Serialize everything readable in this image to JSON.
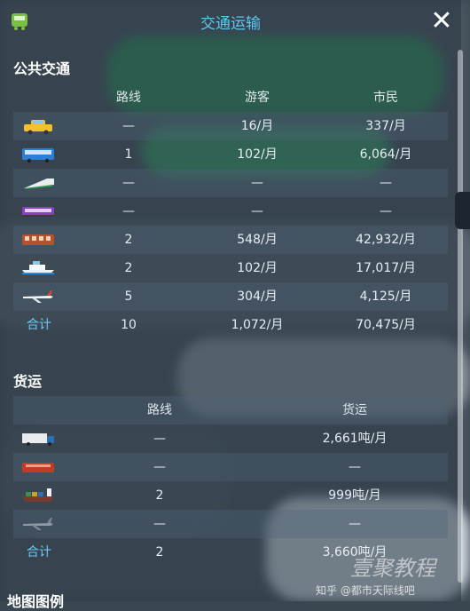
{
  "window": {
    "title": "交通运输"
  },
  "public_transport": {
    "heading": "公共交通",
    "columns": [
      "路线",
      "游客",
      "市民"
    ],
    "rows": [
      {
        "icon": "taxi-icon",
        "routes": "—",
        "tourists": "16/月",
        "citizens": "337/月"
      },
      {
        "icon": "bus-icon",
        "routes": "1",
        "tourists": "102/月",
        "citizens": "6,064/月"
      },
      {
        "icon": "metro-icon",
        "routes": "—",
        "tourists": "—",
        "citizens": "—"
      },
      {
        "icon": "tram-icon",
        "routes": "—",
        "tourists": "—",
        "citizens": "—"
      },
      {
        "icon": "train-icon",
        "routes": "2",
        "tourists": "548/月",
        "citizens": "42,932/月"
      },
      {
        "icon": "ship-icon",
        "routes": "2",
        "tourists": "102/月",
        "citizens": "17,017/月"
      },
      {
        "icon": "airplane-icon",
        "routes": "5",
        "tourists": "304/月",
        "citizens": "4,125/月"
      }
    ],
    "total": {
      "label": "合计",
      "routes": "10",
      "tourists": "1,072/月",
      "citizens": "70,475/月"
    }
  },
  "cargo": {
    "heading": "货运",
    "columns": [
      "路线",
      "货运"
    ],
    "rows": [
      {
        "icon": "truck-icon",
        "routes": "—",
        "cargo": "2,661吨/月"
      },
      {
        "icon": "cargo-train-icon",
        "routes": "—",
        "cargo": "—"
      },
      {
        "icon": "cargo-ship-icon",
        "routes": "2",
        "cargo": "999吨/月"
      },
      {
        "icon": "cargo-plane-icon",
        "routes": "—",
        "cargo": "—"
      }
    ],
    "total": {
      "label": "合计",
      "routes": "2",
      "cargo": "3,660吨/月"
    }
  },
  "legend": {
    "heading": "地图图例"
  },
  "watermark": {
    "brand": "壹聚教程",
    "credit": "知乎 @都市天际线吧"
  },
  "colors": {
    "title": "#5ec8ef",
    "total_label": "#6ec6f2",
    "panel": "#283744"
  }
}
